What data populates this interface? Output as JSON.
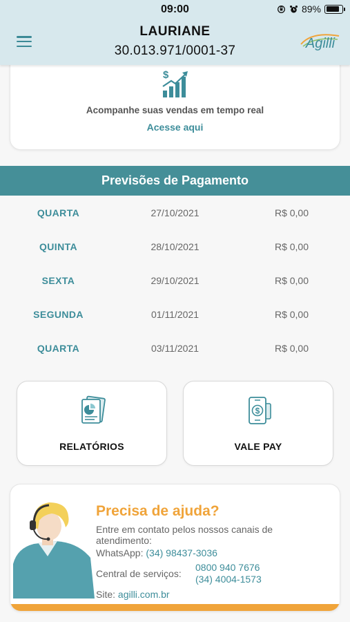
{
  "status_bar": {
    "time": "09:00",
    "battery_text": "89%",
    "battery_level": 0.89
  },
  "header": {
    "name": "LAURIANE",
    "cnpj": "30.013.971/0001-37",
    "logo_text": "Agilli"
  },
  "sales_card": {
    "text": "Acompanhe suas vendas em tempo real",
    "link": "Acesse aqui"
  },
  "payments": {
    "title": "Previsões de Pagamento",
    "rows": [
      {
        "day": "QUARTA",
        "date": "27/10/2021",
        "value": "R$ 0,00"
      },
      {
        "day": "QUINTA",
        "date": "28/10/2021",
        "value": "R$ 0,00"
      },
      {
        "day": "SEXTA",
        "date": "29/10/2021",
        "value": "R$ 0,00"
      },
      {
        "day": "SEGUNDA",
        "date": "01/11/2021",
        "value": "R$ 0,00"
      },
      {
        "day": "QUARTA",
        "date": "03/11/2021",
        "value": "R$ 0,00"
      }
    ]
  },
  "actions": {
    "reports_label": "RELATÓRIOS",
    "valepay_label": "VALE PAY"
  },
  "help": {
    "title": "Precisa de ajuda?",
    "description": "Entre em contato pelos nossos canais de atendimento:",
    "whatsapp_label": "WhatsApp:",
    "whatsapp": "(34) 98437-3036",
    "central_label": "Central de serviços:",
    "central_phone_1": "0800 940 7676",
    "central_phone_2": "(34) 4004-1573",
    "site_label": "Site:",
    "site": "agilli.com.br"
  },
  "colors": {
    "header_bg": "#d7e8ed",
    "teal": "#3d8d9a",
    "teal_bar": "#458f98",
    "orange": "#f0a43a"
  },
  "icons": [
    "menu-icon",
    "agilli-logo",
    "sales-growth-icon",
    "reports-icon",
    "vale-pay-icon",
    "support-agent-icon",
    "alarm-icon",
    "orientation-lock-icon",
    "battery-icon"
  ]
}
